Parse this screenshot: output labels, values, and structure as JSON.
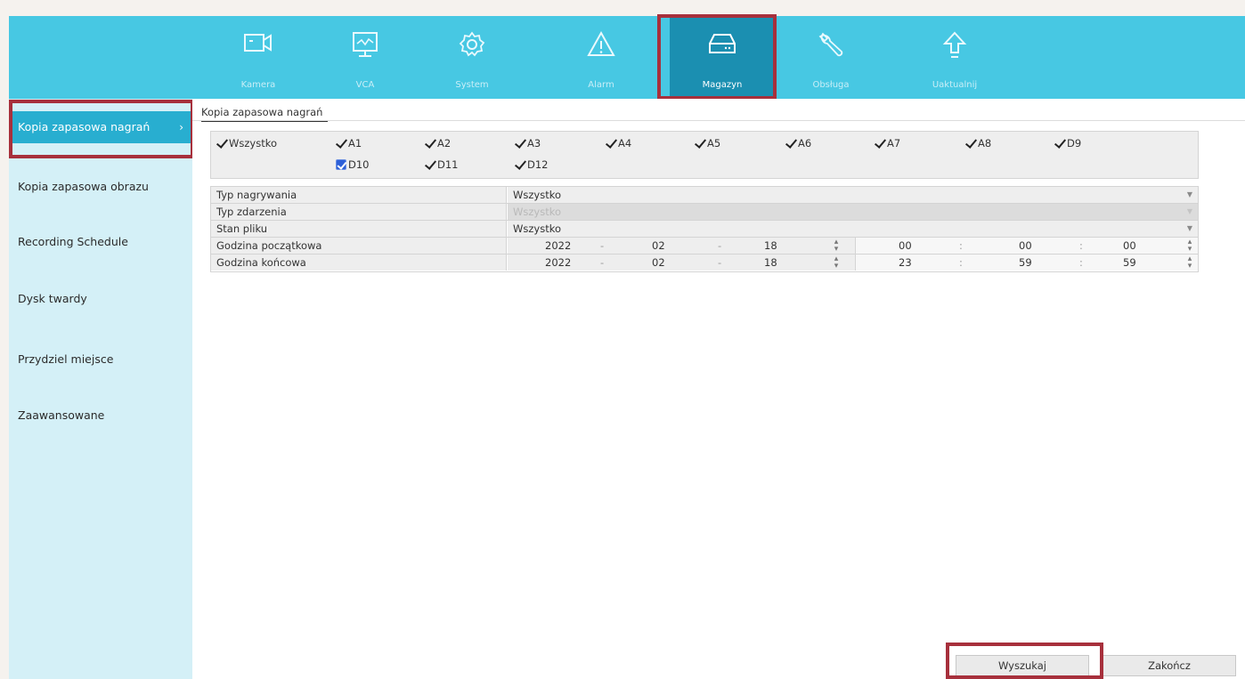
{
  "nav": {
    "items": [
      {
        "label": "Kamera",
        "icon": "camera-icon"
      },
      {
        "label": "VCA",
        "icon": "monitor-icon"
      },
      {
        "label": "System",
        "icon": "gear-icon"
      },
      {
        "label": "Alarm",
        "icon": "warning-icon"
      },
      {
        "label": "Magazyn",
        "icon": "storage-icon",
        "active": true
      },
      {
        "label": "Obsługa",
        "icon": "wrench-icon"
      },
      {
        "label": "Uaktualnij",
        "icon": "upgrade-arrow-icon"
      }
    ]
  },
  "sidebar": {
    "items": [
      {
        "label": "Kopia zapasowa nagrań",
        "active": true
      },
      {
        "label": "Kopia zapasowa obrazu"
      },
      {
        "label": "Recording Schedule"
      },
      {
        "label": "Dysk twardy"
      },
      {
        "label": "Przydziel miejsce"
      },
      {
        "label": "Zaawansowane"
      }
    ]
  },
  "main": {
    "tab": "Kopia zapasowa nagrań",
    "channels": {
      "all": "Wszystko",
      "list": [
        "A1",
        "A2",
        "A3",
        "A4",
        "A5",
        "A6",
        "A7",
        "A8",
        "D9",
        "D10",
        "D11",
        "D12"
      ]
    },
    "form": {
      "record_type": {
        "label": "Typ nagrywania",
        "value": "Wszystko"
      },
      "event_type": {
        "label": "Typ zdarzenia",
        "value": "Wszystko"
      },
      "file_state": {
        "label": "Stan pliku",
        "value": "Wszystko"
      },
      "start": {
        "label": "Godzina początkowa",
        "year": "2022",
        "month": "02",
        "day": "18",
        "hour": "00",
        "minute": "00",
        "second": "00"
      },
      "end": {
        "label": "Godzina końcowa",
        "year": "2022",
        "month": "02",
        "day": "18",
        "hour": "23",
        "minute": "59",
        "second": "59"
      },
      "date_sep": "-",
      "time_sep": ":"
    },
    "buttons": {
      "search": "Wyszukaj",
      "exit": "Zakończ"
    }
  },
  "colors": {
    "nav_bg": "#47c8e3",
    "nav_active": "#1b8fb1",
    "sidebar_bg": "#d4f0f7",
    "sidebar_active": "#28aed0",
    "highlight_frame": "#a7303c"
  }
}
